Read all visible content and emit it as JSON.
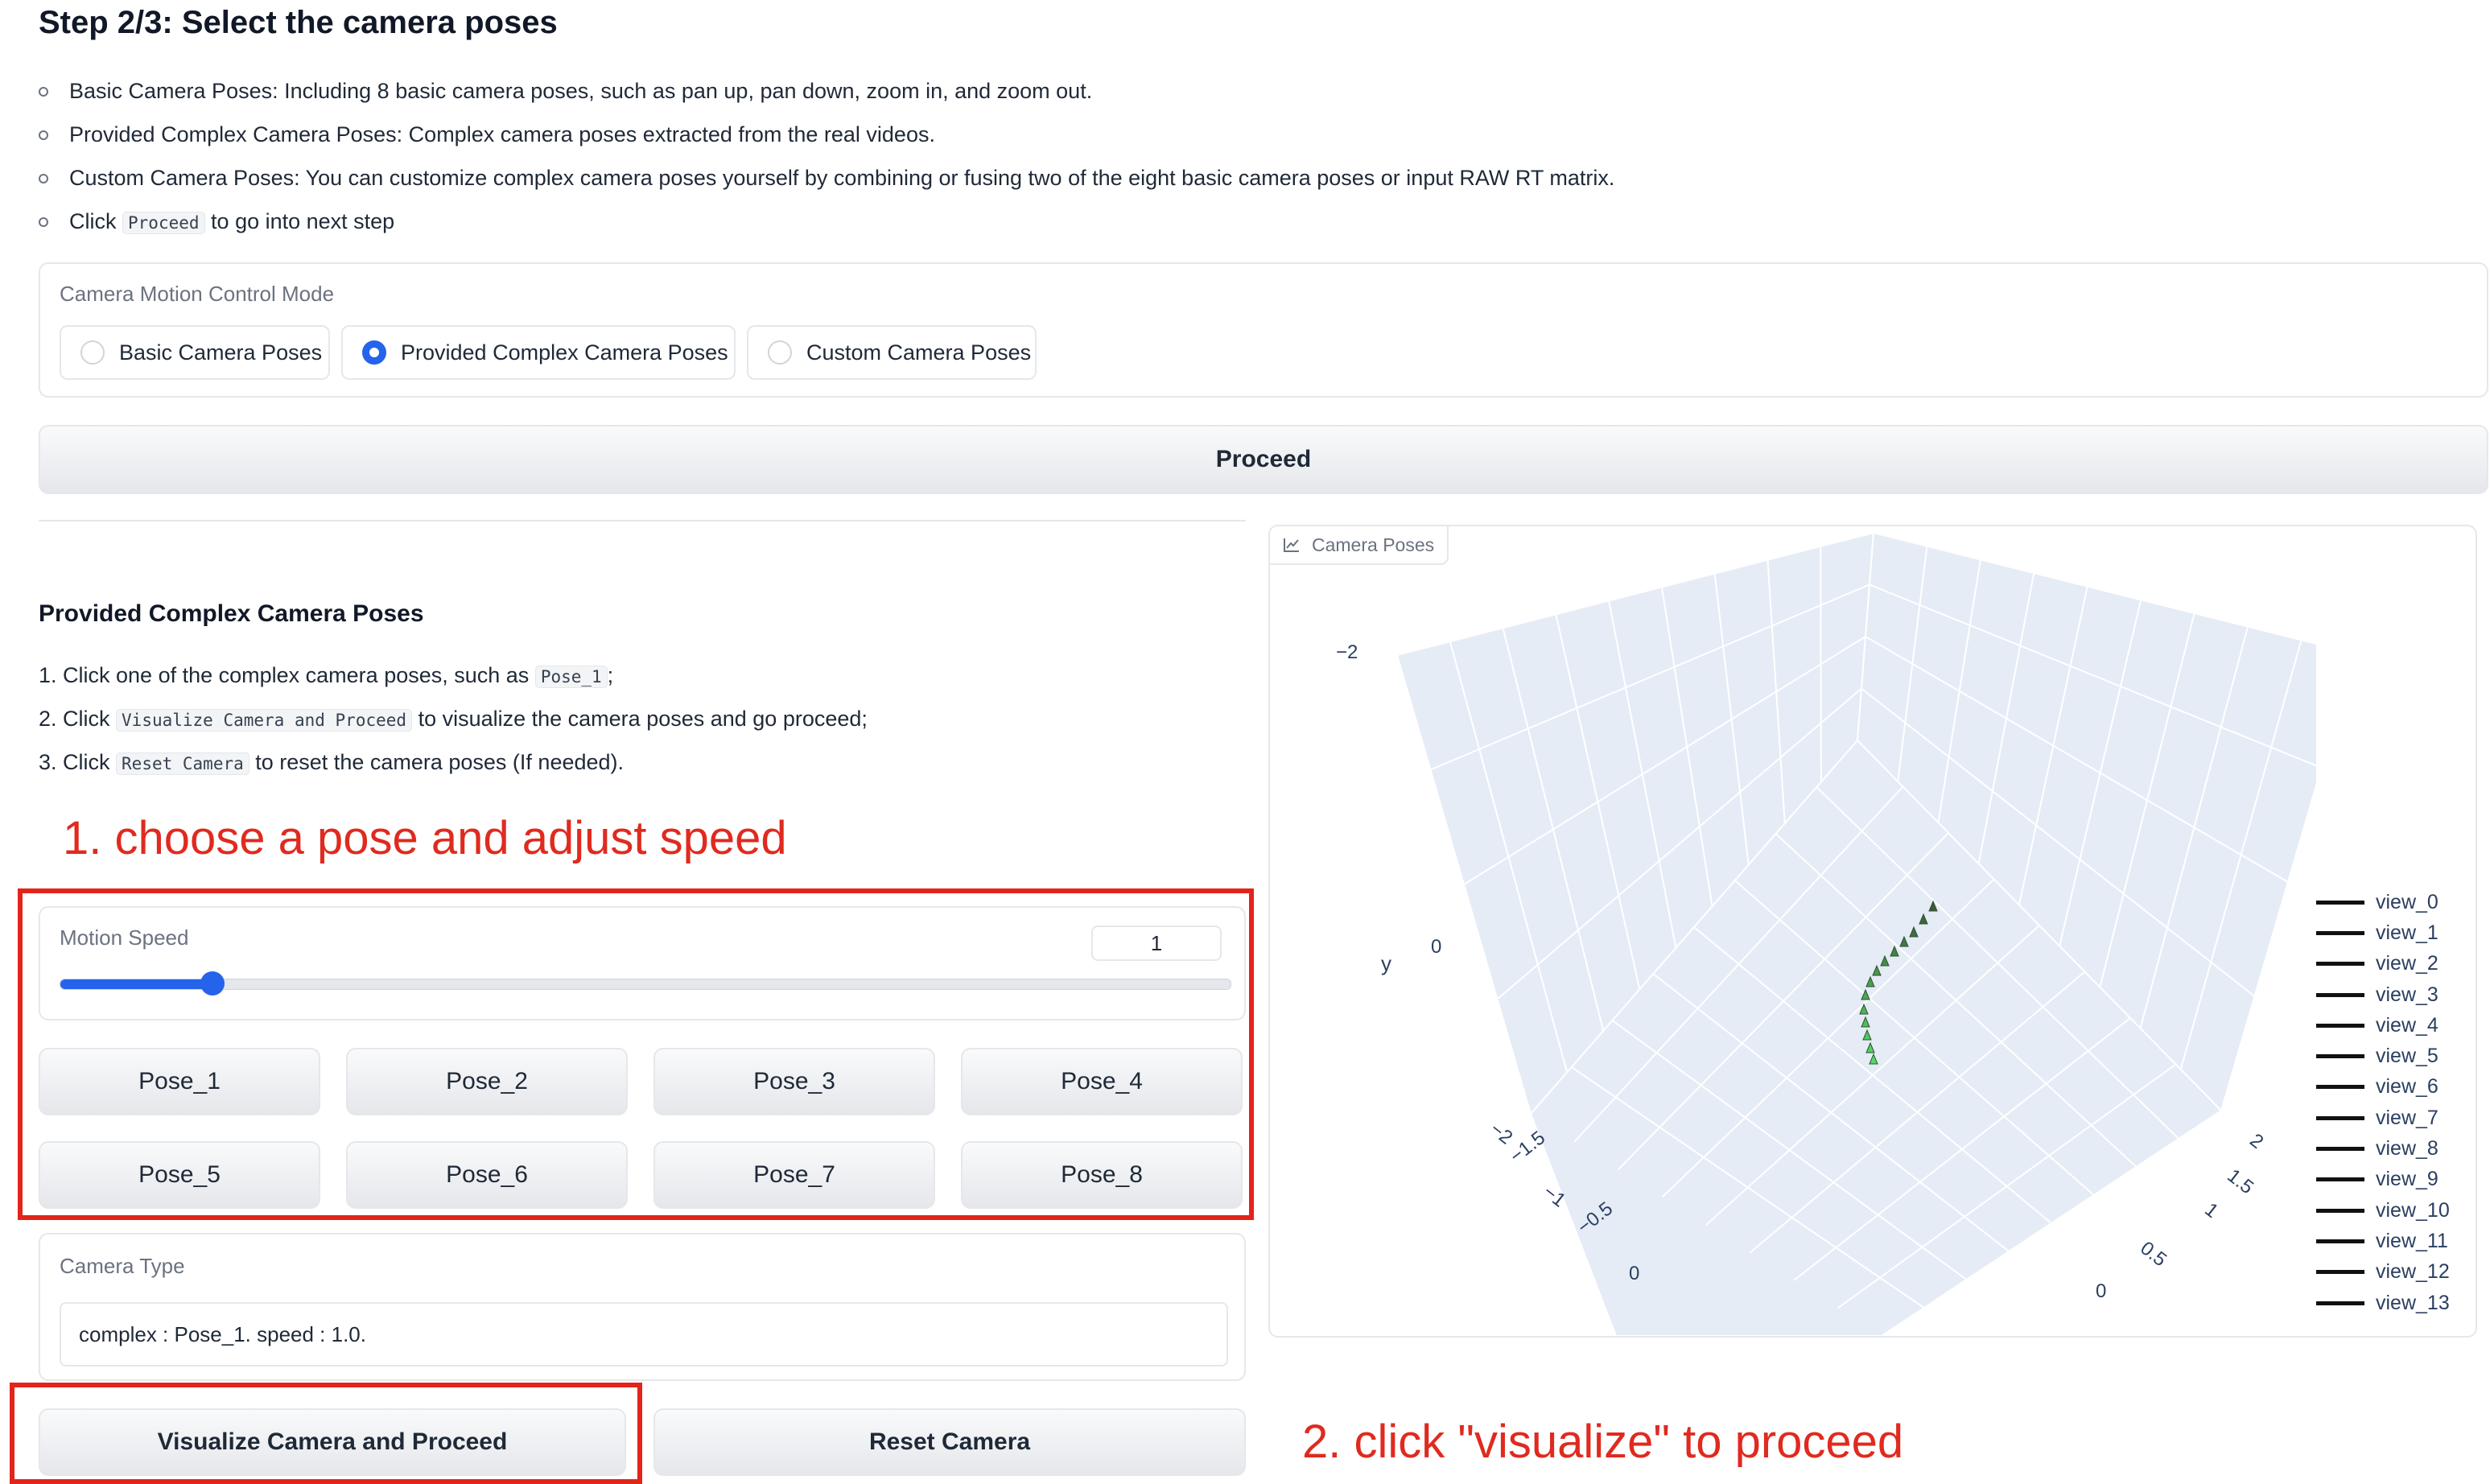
{
  "header": {
    "title": "Step 2/3: Select the camera poses"
  },
  "intro": {
    "items": [
      "Basic Camera Poses: Including 8 basic camera poses, such as pan up, pan down, zoom in, and zoom out.",
      "Provided Complex Camera Poses: Complex camera poses extracted from the real videos.",
      "Custom Camera Poses: You can customize complex camera poses yourself by combining or fusing two of the eight basic camera poses or input RAW RT matrix."
    ],
    "click_pre": "Click",
    "click_code": "Proceed",
    "click_post": "to go into next step"
  },
  "mode": {
    "label": "Camera Motion Control Mode",
    "options": [
      "Basic Camera Poses",
      "Provided Complex Camera Poses",
      "Custom Camera Poses"
    ],
    "selected": "Provided Complex Camera Poses"
  },
  "proceed_label": "Proceed",
  "complex": {
    "title": "Provided Complex Camera Poses",
    "s1_pre": "1. Click one of the complex camera poses, such as",
    "s1_code": "Pose_1",
    "s1_post": ";",
    "s2_pre": "2. Click",
    "s2_code": "Visualize Camera and Proceed",
    "s2_post": "to visualize the camera poses and go proceed;",
    "s3_pre": "3. Click",
    "s3_code": "Reset Camera",
    "s3_post": "to reset the camera poses (If needed)."
  },
  "annotations": {
    "a1": "1. choose a pose and adjust speed",
    "a2": "2. click \"visualize\" to proceed",
    "color": "#e02a1f"
  },
  "speed": {
    "label": "Motion Speed",
    "value": "1",
    "slider_fraction": 0.13
  },
  "poses": [
    "Pose_1",
    "Pose_2",
    "Pose_3",
    "Pose_4",
    "Pose_5",
    "Pose_6",
    "Pose_7",
    "Pose_8"
  ],
  "camera_type": {
    "label": "Camera Type",
    "value": "complex : Pose_1. speed : 1.0."
  },
  "actions": {
    "visualize": "Visualize Camera and Proceed",
    "reset": "Reset Camera"
  },
  "plot": {
    "tab_label": "Camera Poses",
    "y_axis_title": "y",
    "y_ticks": [
      "−2",
      "0"
    ],
    "left_axis_ticks": [
      "−2",
      "−1.5",
      "−1",
      "−0.5",
      "0"
    ],
    "right_axis_ticks": [
      "2",
      "1.5",
      "1",
      "0.5",
      "0"
    ],
    "legend": [
      "view_0",
      "view_1",
      "view_2",
      "view_3",
      "view_4",
      "view_5",
      "view_6",
      "view_7",
      "view_8",
      "view_9",
      "view_10",
      "view_11",
      "view_12",
      "view_13"
    ]
  },
  "colors": {
    "accent": "#2563eb",
    "scene_bg": "#e5ecf6",
    "red": "#e3241b"
  }
}
